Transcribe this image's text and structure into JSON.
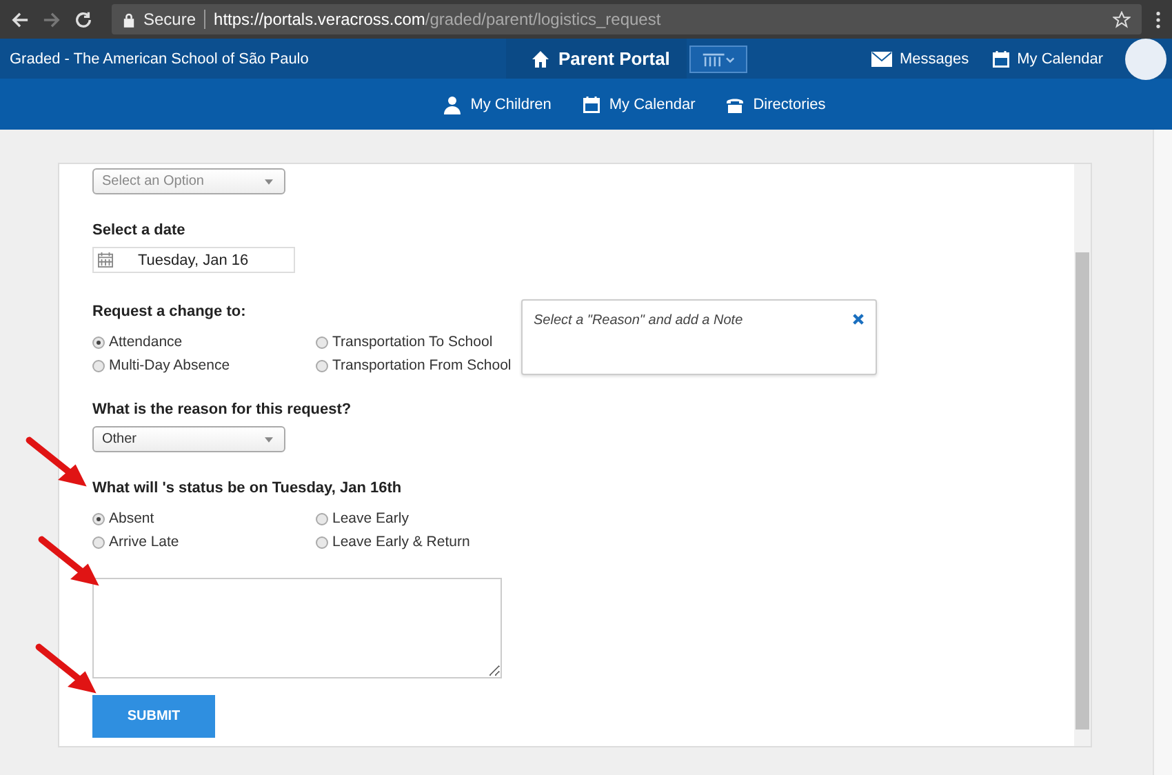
{
  "browser": {
    "secure_label": "Secure",
    "url_host": "https://portals.veracross.com",
    "url_path": "/graded/parent/logistics_request"
  },
  "header": {
    "school": "Graded - The American School of São Paulo",
    "portal": "Parent Portal",
    "links": [
      {
        "label": "Messages",
        "kind": "mail"
      },
      {
        "label": "My Calendar",
        "kind": "calendar"
      }
    ]
  },
  "subnav": [
    {
      "label": "My Children",
      "kind": "person"
    },
    {
      "label": "My Calendar",
      "kind": "calendar"
    },
    {
      "label": "Directories",
      "kind": "phone"
    }
  ],
  "form": {
    "child_select": {
      "placeholder": "Select an Option"
    },
    "date": {
      "label": "Select a date",
      "value": "Tuesday, Jan 16"
    },
    "change": {
      "label": "Request a change to:",
      "options": [
        {
          "label": "Attendance",
          "selected": true
        },
        {
          "label": "Transportation To School",
          "selected": false
        },
        {
          "label": "Multi-Day Absence",
          "selected": false
        },
        {
          "label": "Transportation From School",
          "selected": false
        }
      ]
    },
    "tooltip": {
      "text": "Select a \"Reason\" and add a Note"
    },
    "reason": {
      "label": "What is the reason for this request?",
      "value": "Other"
    },
    "status": {
      "label": "What will 's status be on Tuesday, Jan 16th",
      "options": [
        {
          "label": "Absent",
          "selected": true
        },
        {
          "label": "Leave Early",
          "selected": false
        },
        {
          "label": "Arrive Late",
          "selected": false
        },
        {
          "label": "Leave Early & Return",
          "selected": false
        }
      ]
    },
    "submit": "SUBMIT"
  }
}
